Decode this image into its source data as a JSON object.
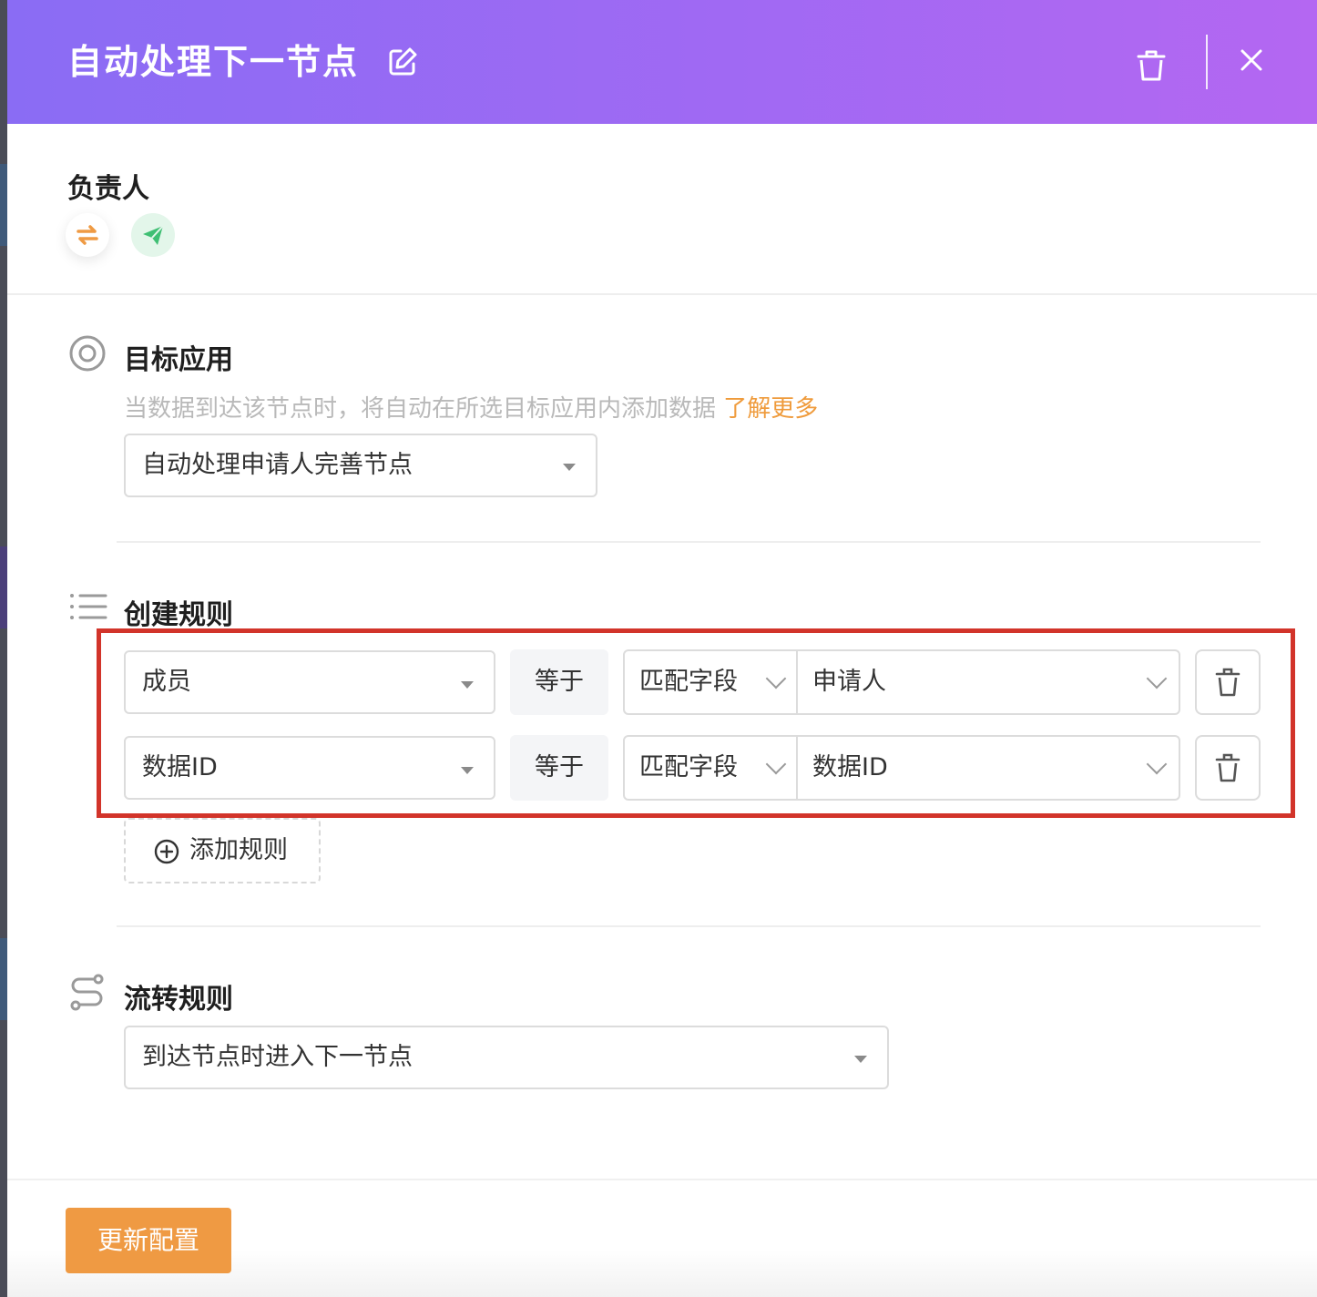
{
  "header": {
    "title": "自动处理下一节点",
    "edit_icon": "edit-icon",
    "delete_icon": "trash-icon",
    "close_icon": "close-icon"
  },
  "owner": {
    "label": "负责人",
    "icons": [
      "swap-icon",
      "paper-plane-icon"
    ]
  },
  "target_app": {
    "title": "目标应用",
    "description": "当数据到达该节点时，将自动在所选目标应用内添加数据",
    "learn_more": "了解更多",
    "selected": "自动处理申请人完善节点"
  },
  "create_rules": {
    "title": "创建规则",
    "rules": [
      {
        "field": "成员",
        "operator": "等于",
        "match_type": "匹配字段",
        "match_value": "申请人"
      },
      {
        "field": "数据ID",
        "operator": "等于",
        "match_type": "匹配字段",
        "match_value": "数据ID"
      }
    ],
    "add_rule_label": "添加规则"
  },
  "flow_rules": {
    "title": "流转规则",
    "selected": "到达节点时进入下一节点"
  },
  "footer": {
    "update_label": "更新配置"
  },
  "colors": {
    "header_gradient_start": "#8a6cf4",
    "header_gradient_end": "#b467f2",
    "accent_orange": "#ef9a43",
    "highlight_frame": "#d2342a"
  }
}
